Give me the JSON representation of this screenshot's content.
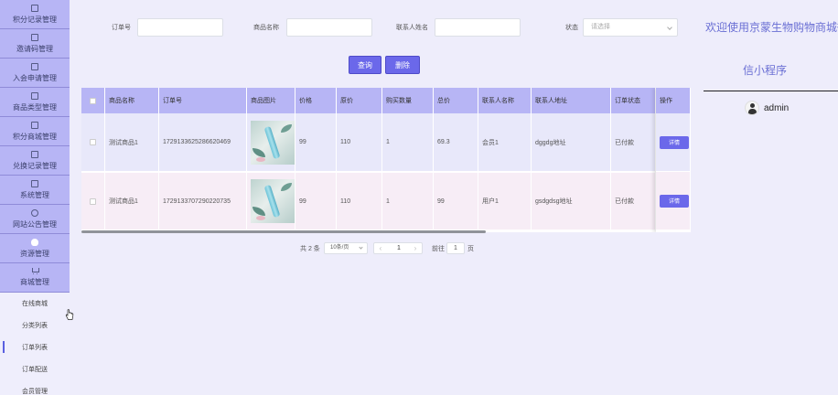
{
  "sidebar": {
    "menu": [
      {
        "label": "积分记录管理",
        "icon": "doc-icon"
      },
      {
        "label": "邀请码管理",
        "icon": "doc-icon"
      },
      {
        "label": "入会申请管理",
        "icon": "doc-icon"
      },
      {
        "label": "商品类型管理",
        "icon": "doc-icon"
      },
      {
        "label": "积分商城管理",
        "icon": "doc-icon"
      },
      {
        "label": "兑换记录管理",
        "icon": "doc-icon"
      },
      {
        "label": "系统管理",
        "icon": "image-icon"
      },
      {
        "label": "网站公告管理",
        "icon": "info-icon"
      },
      {
        "label": "资源管理",
        "icon": "bulb-icon"
      },
      {
        "label": "商城管理",
        "icon": "cart-icon"
      }
    ],
    "submenu": [
      {
        "label": "在线商城"
      },
      {
        "label": "分类列表"
      },
      {
        "label": "订单列表"
      },
      {
        "label": "订单配送"
      },
      {
        "label": "会员管理"
      }
    ],
    "active_submenu": "订单列表"
  },
  "search": {
    "order_no_label": "订单号",
    "order_no_value": "",
    "product_name_label": "商品名称",
    "product_name_value": "",
    "contact_name_label": "联系人姓名",
    "contact_name_value": "",
    "status_label": "状态",
    "status_placeholder": "请选择",
    "query_button": "查询",
    "delete_button": "删除"
  },
  "table": {
    "headers": [
      "商品名称",
      "订单号",
      "商品图片",
      "价格",
      "原价",
      "购买数量",
      "总价",
      "联系人名称",
      "联系人地址",
      "订单状态",
      "操作"
    ],
    "rows": [
      {
        "product_name": "测试商品1",
        "order_no": "1729133625286620469",
        "price": "99",
        "original_price": "110",
        "quantity": "1",
        "total": "69.3",
        "contact_name": "会员1",
        "contact_address": "dggdg地址",
        "status": "已付款",
        "action": "详情"
      },
      {
        "product_name": "测试商品1",
        "order_no": "1729133707290220735",
        "price": "99",
        "original_price": "110",
        "quantity": "1",
        "total": "99",
        "contact_name": "用户1",
        "contact_address": "gsdgdsg地址",
        "status": "已付款",
        "action": "详情"
      }
    ]
  },
  "pagination": {
    "total": "共 2 条",
    "page_size": "10条/页",
    "prev": "‹",
    "current_page": "1",
    "next": "›",
    "goto_label": "前往",
    "goto_value": "1",
    "page_suffix": "页"
  },
  "right_panel": {
    "welcome": "欢迎使用京蒙生物购物商城微",
    "subtitle": "信小程序",
    "username": "admin"
  },
  "colors": {
    "accent": "#6b68ea",
    "sidebar_menu": "#b7b5f5",
    "background": "#eeedfb",
    "title_text": "#6a6fd4"
  }
}
